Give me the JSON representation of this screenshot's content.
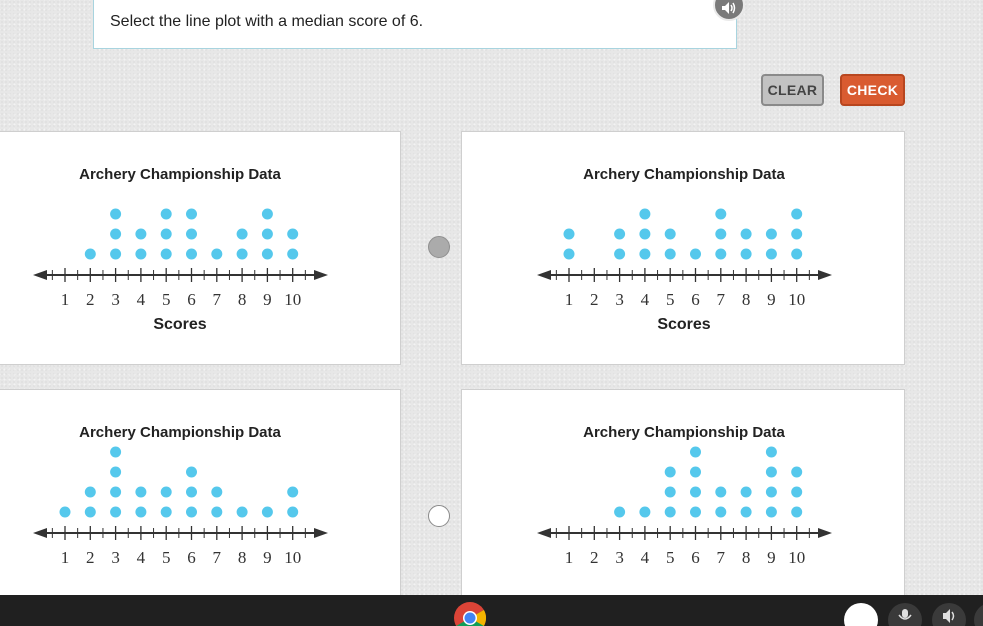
{
  "question": {
    "text": "Select the line plot with a median score of 6.",
    "speaker_icon": "speaker-icon"
  },
  "buttons": {
    "clear_label": "CLEAR",
    "check_label": "CHECK"
  },
  "colors": {
    "dot": "#55c8ec",
    "check_button": "#d95b30",
    "clear_button": "#c2c2c2",
    "question_border": "#a8d4df",
    "radio_selected": "#ababab"
  },
  "plots": [
    {
      "title": "Archery Championship Data",
      "xlabel": "Scores",
      "ticks": [
        "1",
        "2",
        "3",
        "4",
        "5",
        "6",
        "7",
        "8",
        "9",
        "10"
      ],
      "counts": [
        0,
        1,
        3,
        2,
        3,
        3,
        1,
        2,
        3,
        2
      ]
    },
    {
      "title": "Archery Championship Data",
      "xlabel": "Scores",
      "ticks": [
        "1",
        "2",
        "3",
        "4",
        "5",
        "6",
        "7",
        "8",
        "9",
        "10"
      ],
      "counts": [
        2,
        0,
        2,
        3,
        2,
        1,
        3,
        2,
        2,
        3
      ]
    },
    {
      "title": "Archery Championship Data",
      "xlabel": "",
      "ticks": [
        "1",
        "2",
        "3",
        "4",
        "5",
        "6",
        "7",
        "8",
        "9",
        "10"
      ],
      "counts": [
        1,
        2,
        4,
        2,
        2,
        3,
        2,
        1,
        1,
        2
      ]
    },
    {
      "title": "Archery Championship Data",
      "xlabel": "",
      "ticks": [
        "1",
        "2",
        "3",
        "4",
        "5",
        "6",
        "7",
        "8",
        "9",
        "10"
      ],
      "counts": [
        0,
        0,
        1,
        1,
        3,
        4,
        2,
        2,
        4,
        3
      ]
    }
  ],
  "chart_data": [
    {
      "type": "scatter",
      "title": "Archery Championship Data",
      "xlabel": "Scores",
      "categories": [
        "1",
        "2",
        "3",
        "4",
        "5",
        "6",
        "7",
        "8",
        "9",
        "10"
      ],
      "values": [
        0,
        1,
        3,
        2,
        3,
        3,
        1,
        2,
        3,
        2
      ]
    },
    {
      "type": "scatter",
      "title": "Archery Championship Data",
      "xlabel": "Scores",
      "categories": [
        "1",
        "2",
        "3",
        "4",
        "5",
        "6",
        "7",
        "8",
        "9",
        "10"
      ],
      "values": [
        2,
        0,
        2,
        3,
        2,
        1,
        3,
        2,
        2,
        3
      ]
    },
    {
      "type": "scatter",
      "title": "Archery Championship Data",
      "xlabel": "",
      "categories": [
        "1",
        "2",
        "3",
        "4",
        "5",
        "6",
        "7",
        "8",
        "9",
        "10"
      ],
      "values": [
        1,
        2,
        4,
        2,
        2,
        3,
        2,
        1,
        1,
        2
      ]
    },
    {
      "type": "scatter",
      "title": "Archery Championship Data",
      "xlabel": "",
      "categories": [
        "1",
        "2",
        "3",
        "4",
        "5",
        "6",
        "7",
        "8",
        "9",
        "10"
      ],
      "values": [
        0,
        0,
        1,
        1,
        3,
        4,
        2,
        2,
        4,
        3
      ]
    }
  ],
  "radios": [
    {
      "state": "selected"
    },
    {
      "state": "unselected"
    }
  ],
  "taskbar": {
    "launcher_icon": "chrome-icon",
    "tray_icons": [
      "account-avatar-icon",
      "microphone-icon",
      "audio-icon"
    ]
  }
}
